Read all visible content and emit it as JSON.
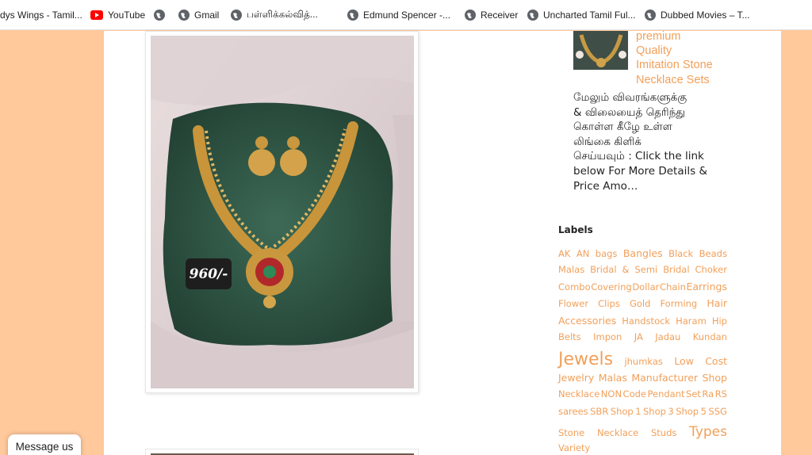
{
  "bookmarks": [
    {
      "label": "dys Wings - Tamil...",
      "icon": "none"
    },
    {
      "label": "YouTube",
      "icon": "youtube-icon"
    },
    {
      "label": "",
      "icon": "globe-icon"
    },
    {
      "label": "Gmail",
      "icon": "globe-icon"
    },
    {
      "label": "பள்ளிக்கல்வித்...",
      "icon": "globe-icon"
    },
    {
      "label": "Edmund Spencer -...",
      "icon": "globe-icon"
    },
    {
      "label": "Receiver",
      "icon": "globe-icon"
    },
    {
      "label": "Uncharted Tamil Ful...",
      "icon": "globe-icon"
    },
    {
      "label": "Dubbed Movies – T...",
      "icon": "globe-icon"
    }
  ],
  "product": {
    "price_tag": "960/-"
  },
  "sidebar": {
    "post_title_lines": [
      "premium",
      "Quality",
      "Imitation Stone",
      "Necklace Sets"
    ],
    "description_lines": [
      "மேலும் விவரங்களுக்கு",
      "& விலையைத் தெரிந்து",
      "கொள்ள கீழே உள்ள",
      "லிங்கை கிளிக்",
      "செய்யவும் : Click the link",
      "below For More Details &",
      "Price Amo…"
    ],
    "labels_heading": "Labels",
    "labels": [
      [
        "AK",
        "AN",
        "bags",
        "Bangles",
        "Black",
        "Beads"
      ],
      [
        "Malas",
        "Bridal",
        "&",
        "Semi",
        "Bridal",
        "Choker"
      ],
      [
        "Combo",
        "Covering",
        "Dollar",
        "Chain",
        "Earrings"
      ],
      [
        "Flower",
        "Clips",
        "Gold",
        "Forming",
        "Hair"
      ],
      [
        "Accessories",
        "Handstock",
        "Haram",
        "Hip"
      ],
      [
        "Belts",
        "Impon",
        "JA",
        "Jadau",
        "Kundan"
      ],
      [
        "Jewels",
        "jhumkas",
        "Low",
        "Cost"
      ],
      [
        "Jewelry",
        "Malas",
        "Manufacturer",
        "Shop"
      ],
      [
        "Necklace",
        "NON",
        "Code",
        "Pendant",
        "Set",
        "Ra",
        "RS"
      ],
      [
        "sarees",
        "SBR",
        "Shop",
        "1",
        "Shop",
        "3",
        "Shop",
        "5",
        "SSG"
      ],
      [
        "Stone",
        "Necklace",
        "Studs",
        "Types"
      ],
      [
        "Variety"
      ]
    ]
  },
  "chat": {
    "message_label": "Message us"
  },
  "colors": {
    "page_background": "#ffc99c",
    "link_orange": "#f2a05a",
    "text_dark": "#222222"
  }
}
